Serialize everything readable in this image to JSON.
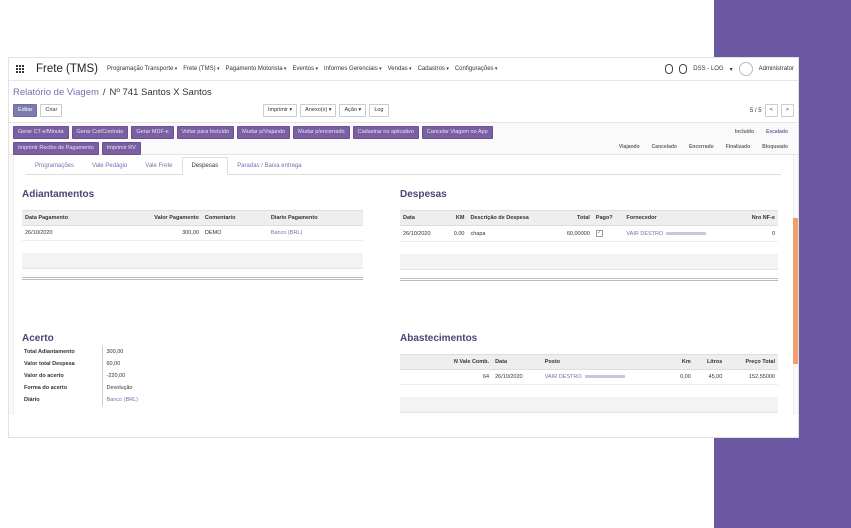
{
  "navbar": {
    "brand": "Frete (TMS)",
    "menu": [
      "Programação Transporte",
      "Frete (TMS)",
      "Pagamento Motorista",
      "Eventos",
      "Informes Gerenciais",
      "Vendas",
      "Cadastros",
      "Configurações"
    ],
    "company": "DSS - LOG",
    "user": "Administrator"
  },
  "breadcrumb": {
    "parent": "Relatório de Viagem",
    "current": "Nº 741 Santos X Santos"
  },
  "control": {
    "edit_label": "Editar",
    "create_label": "Criar",
    "print_label": "Imprimir",
    "attach_label": "Anexo(s)",
    "action_label": "Ação",
    "log_label": "Log",
    "pager": "5 / 5"
  },
  "header": {
    "actions_row1": [
      "Gerar CT-e/Minuta",
      "Gerar Cot/Contrato",
      "Gerar MDF-e",
      "Voltar para Incluído",
      "Mudar p/Viajando",
      "Mudar p/encerrado",
      "Cadastrar no aplicativo",
      "Cancelar Viagem no App"
    ],
    "actions_row2": [
      "Imprimir Recibo de Pagamento",
      "Imprimir RV"
    ],
    "status_row1": [
      "Incluído",
      "Escalado"
    ],
    "status_row2": [
      "Viajando",
      "Cancelado",
      "Encerrado",
      "Finalizado",
      "Bloqueado"
    ],
    "current_status": "Escalado"
  },
  "tabs": [
    "Programações",
    "Vale Pedágio",
    "Vale Frete",
    "Despesas",
    "Paradas / Baixa entrega"
  ],
  "active_tab": "Despesas",
  "adiantamentos": {
    "title": "Adiantamentos",
    "columns": [
      "Data Pagamento",
      "Valor Pagamento",
      "Comentario",
      "Diario Pagamento"
    ],
    "rows": [
      [
        "26/10/2020",
        "300,00",
        "DEMO",
        "Banco (BRL)"
      ]
    ]
  },
  "despesas": {
    "title": "Despesas",
    "columns": [
      "Data",
      "KM",
      "Descrição de Despesa",
      "Total",
      "Pago?",
      "Fornecedor",
      "Nro NF-e"
    ],
    "rows": [
      [
        "26/10/2020",
        "0,00",
        "chapa",
        "60,00000",
        "",
        "VAIR DESTRO",
        "0"
      ]
    ]
  },
  "acerto": {
    "title": "Acerto",
    "fields": [
      {
        "label": "Total Adiantamento",
        "value": "300,00"
      },
      {
        "label": "Valor total Despesa",
        "value": "60,00"
      },
      {
        "label": "Valor do acerto",
        "value": "-220,00"
      },
      {
        "label": "Forma do acerto",
        "value": "Devolução"
      },
      {
        "label": "Diário",
        "value": "Banco (BRL)"
      }
    ]
  },
  "abastecimentos": {
    "title": "Abastecimentos",
    "columns": [
      "N Vale Comb.",
      "Data",
      "Posto",
      "Km",
      "Litros",
      "Preço Total"
    ],
    "rows": [
      [
        "64",
        "26/10/2020",
        "VAIR DESTRO",
        "0,00",
        "45,00",
        "152,55000"
      ]
    ]
  }
}
